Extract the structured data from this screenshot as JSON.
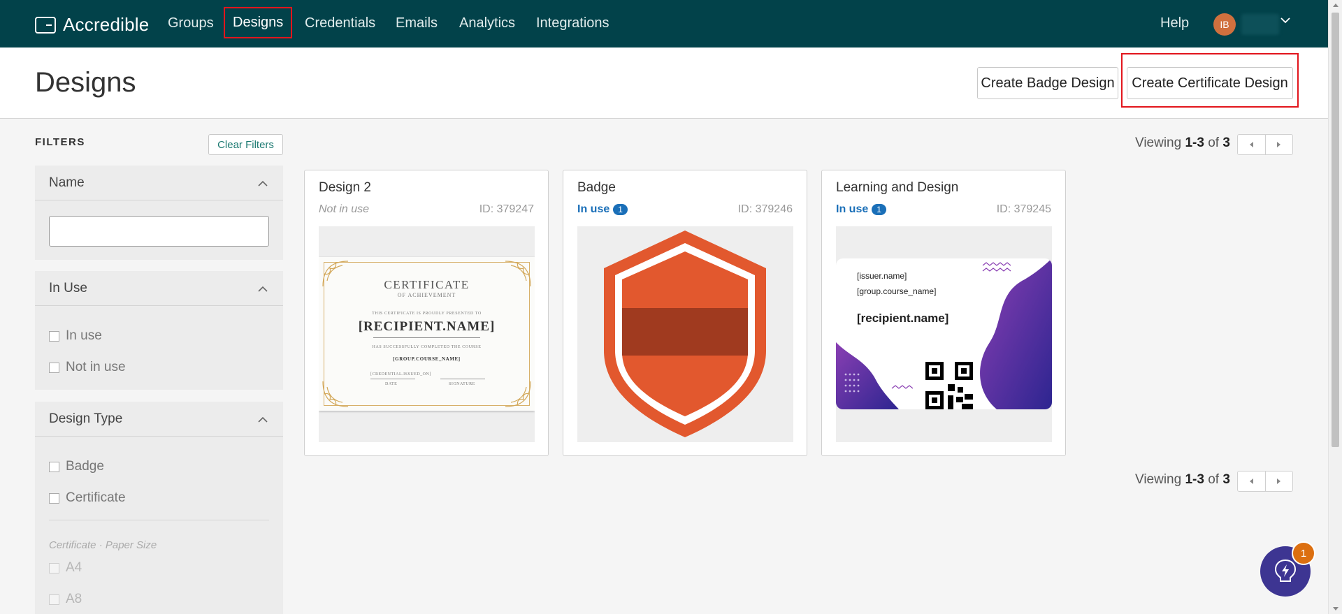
{
  "app": {
    "name": "Accredible"
  },
  "nav": {
    "items": [
      "Groups",
      "Designs",
      "Credentials",
      "Emails",
      "Analytics",
      "Integrations"
    ],
    "help": "Help",
    "user_initials": "IB"
  },
  "page": {
    "title": "Designs",
    "create_badge": "Create Badge Design",
    "create_certificate": "Create Certificate Design"
  },
  "filters": {
    "title": "FILTERS",
    "clear": "Clear Filters",
    "name_section": "Name",
    "inuse_section": "In Use",
    "inuse_options": [
      "In use",
      "Not in use"
    ],
    "type_section": "Design Type",
    "type_options": [
      "Badge",
      "Certificate"
    ],
    "paper_size_label": "Certificate · Paper Size",
    "paper_sizes": [
      "A4",
      "A8"
    ]
  },
  "pagination": {
    "prefix": "Viewing",
    "range": "1-3",
    "of": "of",
    "total": "3"
  },
  "cards": [
    {
      "title": "Design 2",
      "status": "Not in use",
      "count": "",
      "id": "ID: 379247"
    },
    {
      "title": "Badge",
      "status": "In use",
      "count": "1",
      "id": "ID: 379246"
    },
    {
      "title": "Learning and Design",
      "status": "In use",
      "count": "1",
      "id": "ID: 379245"
    }
  ],
  "certificate_preview": {
    "title": "CERTIFICATE",
    "subtitle": "OF ACHIEVEMENT",
    "presented": "THIS CERTIFICATE IS PROUDLY PRESENTED TO",
    "recipient": "[RECIPIENT.NAME]",
    "completed": "HAS SUCCESSFULLY COMPLETED THE COURSE",
    "course": "[GROUP.COURSE_NAME]",
    "date_field": "[CREDENTIAL.ISSUED_ON]",
    "date_label": "DATE",
    "signature_label": "SIGNATURE"
  },
  "learning_preview": {
    "issuer": "[issuer.name]",
    "course": "[group.course_name]",
    "recipient": "[recipient.name]"
  },
  "help_widget": {
    "notification_count": "1"
  },
  "colors": {
    "nav_bg": "#02424a",
    "accent_teal": "#1d7a72",
    "in_use_blue": "#1a6fb8",
    "badge_orange": "#e2582e",
    "highlight_red": "#e2151c",
    "help_purple": "#3d3592"
  }
}
